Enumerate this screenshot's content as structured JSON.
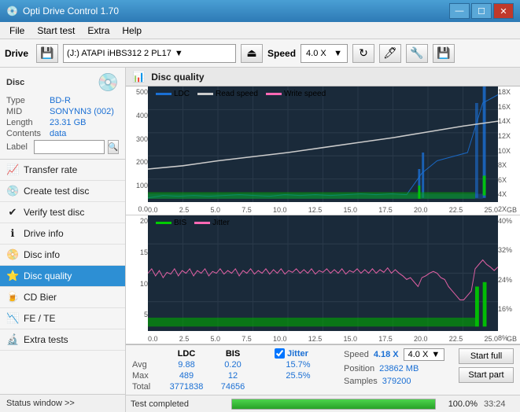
{
  "titleBar": {
    "appName": "Opti Drive Control 1.70",
    "controls": [
      "—",
      "☐",
      "✕"
    ]
  },
  "menuBar": {
    "items": [
      "File",
      "Start test",
      "Extra",
      "Help"
    ]
  },
  "driveToolbar": {
    "driveLabel": "Drive",
    "driveValue": "(J:) ATAPI iHBS312  2 PL17",
    "speedLabel": "Speed",
    "speedValue": "4.0 X"
  },
  "disc": {
    "type": "BD-R",
    "mid": "SONYNN3 (002)",
    "length": "23.31 GB",
    "contents": "data",
    "labelPlaceholder": ""
  },
  "navItems": [
    {
      "id": "transfer-rate",
      "label": "Transfer rate",
      "icon": "📈"
    },
    {
      "id": "create-test-disc",
      "label": "Create test disc",
      "icon": "💿"
    },
    {
      "id": "verify-test-disc",
      "label": "Verify test disc",
      "icon": "✔"
    },
    {
      "id": "drive-info",
      "label": "Drive info",
      "icon": "ℹ"
    },
    {
      "id": "disc-info",
      "label": "Disc info",
      "icon": "📀"
    },
    {
      "id": "disc-quality",
      "label": "Disc quality",
      "icon": "⭐",
      "active": true
    },
    {
      "id": "cd-bier",
      "label": "CD Bier",
      "icon": "🍺"
    },
    {
      "id": "fe-te",
      "label": "FE / TE",
      "icon": "📉"
    },
    {
      "id": "extra-tests",
      "label": "Extra tests",
      "icon": "🔬"
    }
  ],
  "statusWindow": {
    "label": "Status window >>",
    "statusText": "Test completed"
  },
  "chartHeader": {
    "title": "Disc quality"
  },
  "topChart": {
    "title": "LDC",
    "legend": [
      {
        "label": "LDC",
        "color": "#1a6fd4"
      },
      {
        "label": "Read speed",
        "color": "#ffffff"
      },
      {
        "label": "Write speed",
        "color": "#ff69b4"
      }
    ],
    "yLabelsLeft": [
      "500",
      "400",
      "300",
      "200",
      "100",
      "0.0"
    ],
    "yLabelsRight": [
      "18X",
      "16X",
      "14X",
      "12X",
      "10X",
      "8X",
      "6X",
      "4X",
      "2X"
    ],
    "xLabels": [
      "0.0",
      "2.5",
      "5.0",
      "7.5",
      "10.0",
      "12.5",
      "15.0",
      "17.5",
      "20.0",
      "22.5",
      "25.0"
    ],
    "xUnit": "GB"
  },
  "bottomChart": {
    "legend": [
      {
        "label": "BIS",
        "color": "#00cc00"
      },
      {
        "label": "Jitter",
        "color": "#ff69b4"
      }
    ],
    "yLabelsLeft": [
      "20",
      "15",
      "10",
      "5"
    ],
    "yLabelsRight": [
      "40%",
      "32%",
      "24%",
      "16%",
      "8%"
    ],
    "xLabels": [
      "0.0",
      "2.5",
      "5.0",
      "7.5",
      "10.0",
      "12.5",
      "15.0",
      "17.5",
      "20.0",
      "22.5",
      "25.0"
    ],
    "xUnit": "GB"
  },
  "stats": {
    "ldcLabel": "LDC",
    "bisLabel": "BIS",
    "jitterLabel": "Jitter",
    "avgLabel": "Avg",
    "maxLabel": "Max",
    "totalLabel": "Total",
    "ldcAvg": "9.88",
    "ldcMax": "489",
    "ldcTotal": "3771838",
    "bisAvg": "0.20",
    "bisMax": "12",
    "bisTotal": "74656",
    "jitterChecked": true,
    "jitterAvg": "15.7%",
    "jitterMax": "25.5%",
    "speedLabel": "Speed",
    "speedVal": "4.18 X",
    "speedDropdown": "4.0 X",
    "positionLabel": "Position",
    "positionVal": "23862 MB",
    "samplesLabel": "Samples",
    "samplesVal": "379200",
    "startFull": "Start full",
    "startPart": "Start part"
  },
  "progressBar": {
    "statusText": "Test completed",
    "percent": 100,
    "percentLabel": "100.0%",
    "time": "33:24"
  }
}
